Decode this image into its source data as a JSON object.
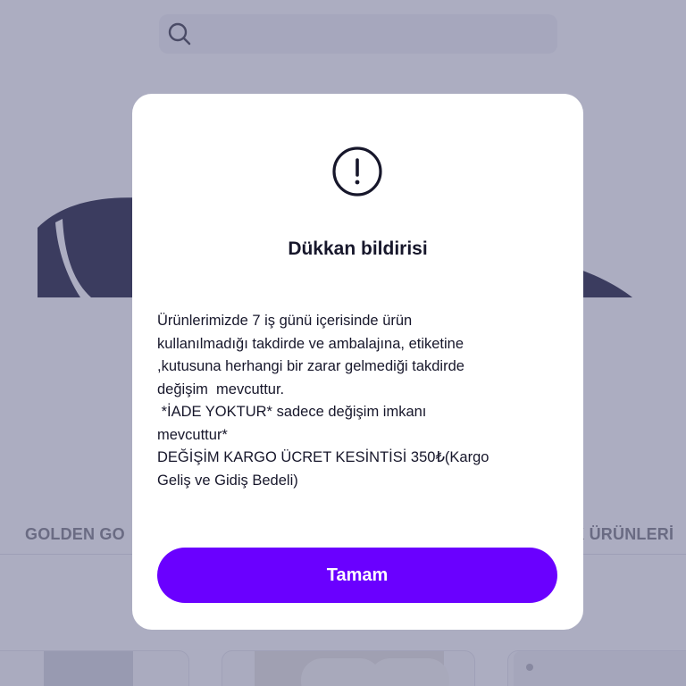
{
  "search": {
    "icon": "search-icon"
  },
  "background": {
    "categories": [
      "GOLDEN GO",
      "CK ÜRÜNLERİ"
    ]
  },
  "dialog": {
    "icon": "alert-circle-icon",
    "title": "Dükkan bildirisi",
    "body_lines": [
      "Ürünlerimizde 7 iş günü içerisinde ürün",
      "kullanılmadığı takdirde ve ambalajına, etiketine",
      ",kutusuna herhangi bir zarar gelmediği takdirde",
      "değişim  mevcuttur.",
      " *İADE YOKTUR* sadece değişim imkanı",
      "mevcuttur*",
      "DEĞİŞİM KARGO ÜCRET KESİNTİSİ 350₺(Kargo",
      "Geliş ve Gidiş Bedeli)"
    ],
    "ok_label": "Tamam"
  },
  "colors": {
    "accent": "#6a00ff",
    "overlay": "#5a5c84",
    "text": "#17172b"
  }
}
